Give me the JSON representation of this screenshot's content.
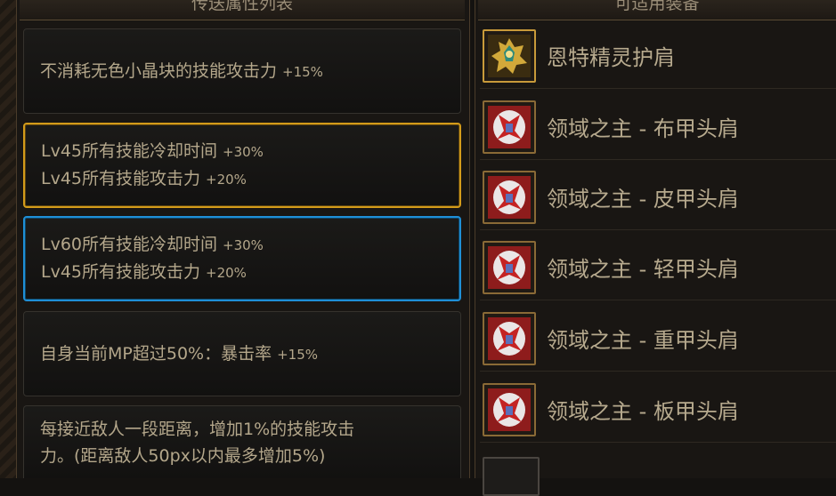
{
  "left_header": "传送属性列表",
  "right_header": "可适用装备",
  "options": [
    {
      "lines": [
        {
          "text": "不消耗无色小晶块的技能攻击力",
          "bonus": "+15%"
        }
      ]
    },
    {
      "lines": [
        {
          "text": "Lv45所有技能冷却时间",
          "bonus": "+30%"
        },
        {
          "text": "Lv45所有技能攻击力",
          "bonus": "+20%"
        }
      ]
    },
    {
      "lines": [
        {
          "text": "Lv60所有技能冷却时间",
          "bonus": "+30%"
        },
        {
          "text": "Lv45所有技能攻击力",
          "bonus": "+20%"
        }
      ]
    },
    {
      "lines": [
        {
          "text": "自身当前MP超过50%：暴击率",
          "bonus": "+15%"
        }
      ]
    },
    {
      "lines": [
        {
          "text": "每接近敌人一段距离，增加1%的技能攻击"
        },
        {
          "text": "力。(距离敌人50px以内最多增加5%)"
        }
      ]
    }
  ],
  "items": [
    {
      "name": "恩特精灵护肩",
      "icon": "elf-shoulder-icon"
    },
    {
      "name": "领域之主 - 布甲头肩",
      "icon": "domain-lord-shoulder-icon"
    },
    {
      "name": "领域之主 - 皮甲头肩",
      "icon": "domain-lord-shoulder-icon"
    },
    {
      "name": "领域之主 - 轻甲头肩",
      "icon": "domain-lord-shoulder-icon"
    },
    {
      "name": "领域之主 - 重甲头肩",
      "icon": "domain-lord-shoulder-icon"
    },
    {
      "name": "领域之主 - 板甲头肩",
      "icon": "domain-lord-shoulder-icon"
    }
  ],
  "colors": {
    "gold_border": "#d39b1a",
    "blue_border": "#1f8fd6",
    "text": "#b4a78b"
  }
}
